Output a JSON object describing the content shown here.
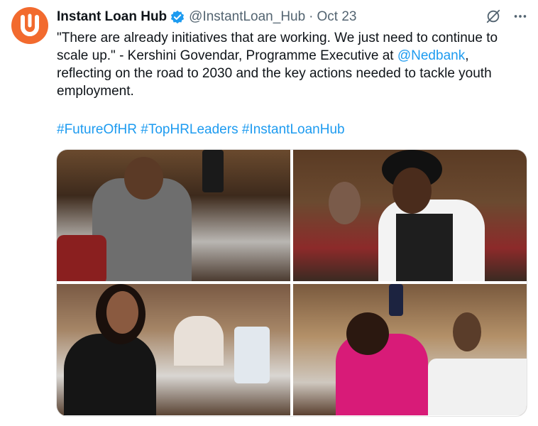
{
  "tweet": {
    "author_name": "Instant Loan Hub",
    "handle": "@InstantLoan_Hub",
    "separator": "·",
    "date": "Oct 23",
    "text_before_mention": "\"There are already initiatives that are working. We just need to continue to scale up.\" - Kershini Govendar, Programme Executive at ",
    "mention": "@Nedbank",
    "text_after_mention": ", reflecting on the road to 2030 and the key actions needed to tackle youth employment.",
    "hashtags": [
      "#FutureOfHR",
      "#TopHRLeaders",
      "#InstantLoanHub"
    ]
  },
  "icons": {
    "avatar": "brand-logo-icon",
    "verified": "verified-badge-icon",
    "grok": "grok-icon",
    "more": "more-icon"
  },
  "colors": {
    "avatar_bg": "#f26a2e",
    "link": "#1d9bf0",
    "verified": "#1d9bf0",
    "secondary_text": "#536471"
  },
  "media": {
    "photo_count": 4
  }
}
